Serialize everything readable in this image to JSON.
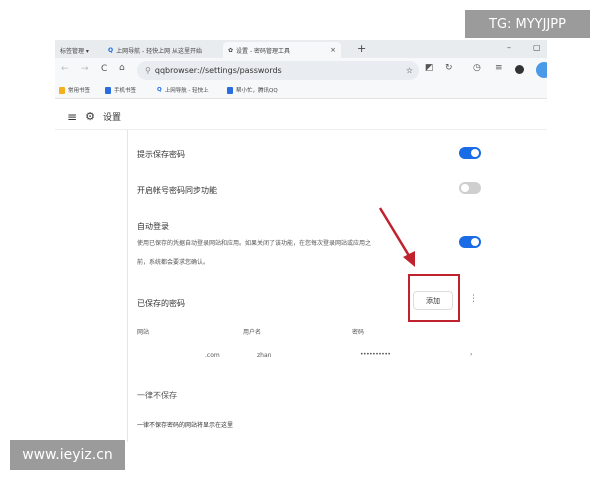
{
  "watermarks": {
    "top_right": "TG: MYYJJPP",
    "bottom_left": "www.ieyiz.cn"
  },
  "tabs": [
    {
      "label": "标签管理 ▾"
    },
    {
      "label": "上网导航 - 轻快上网 从这里开始"
    },
    {
      "label": "设置 - 密码管理工具",
      "active": true
    }
  ],
  "address": {
    "url": "qqbrowser://settings/passwords"
  },
  "bookmarks": [
    {
      "label": "常用书签",
      "color": "#f2b01e"
    },
    {
      "label": "手机书签",
      "color": "#2a6de0"
    },
    {
      "label": "上网导航 - 轻快上",
      "color": "#1a6be6"
    },
    {
      "label": "帮小忙，腾讯QQ",
      "color": "#2a6de0"
    }
  ],
  "header": {
    "title": "设置"
  },
  "settings": [
    {
      "label": "提示保存密码",
      "enabled": true
    },
    {
      "label": "开启帐号密码同步功能",
      "enabled": false
    },
    {
      "label": "自动登录",
      "desc1": "使用已保存的凭据自动登录网站和应用。如果关闭了该功能，在您每次登录网站或应用之",
      "desc2": "前，系统都会要求您确认。",
      "enabled": true
    }
  ],
  "saved": {
    "title": "已保存的密码",
    "add_label": "添加",
    "columns": [
      "网站",
      "用户名",
      "密码"
    ],
    "rows": [
      {
        "site": ".com",
        "user": "zhan",
        "password": "••••••••••"
      }
    ]
  },
  "never": {
    "title": "一律不保存",
    "empty": "一律不保存密码的网站将显示在这里"
  },
  "colors": {
    "accent": "#1a6be6",
    "highlight": "#c0232e"
  }
}
